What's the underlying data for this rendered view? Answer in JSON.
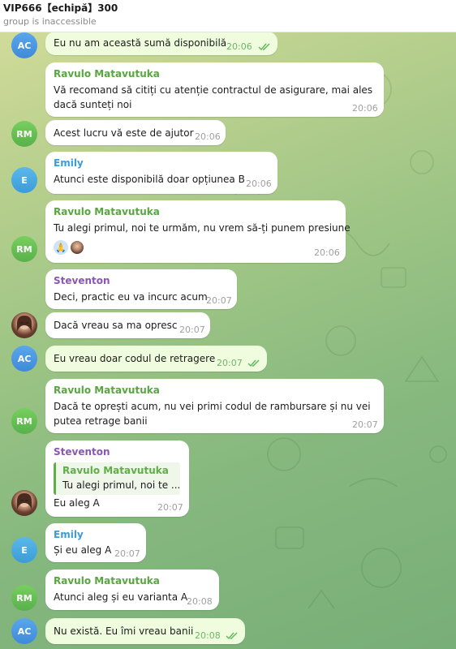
{
  "header": {
    "title": "VIP666【echipă】300",
    "subtitle": "group is inaccessible"
  },
  "messages": [
    {
      "avatar": "AC",
      "text": "Eu nu am această sumă disponibilă",
      "time": "20:06"
    },
    {
      "sender": "Ravulo Matavutuka",
      "lines": [
        "Vă recomand să citiți cu atenție contractul de asigurare, mai ales",
        "dacă sunteți noi"
      ],
      "time": "20:06"
    },
    {
      "avatar": "RM",
      "text": "Acest lucru vă este de ajutor",
      "time": "20:06"
    },
    {
      "avatar": "E",
      "sender": "Emily",
      "text": "Atunci este disponibilă doar opțiunea B",
      "time": "20:06"
    },
    {
      "avatar": "RM",
      "sender": "Ravulo Matavutuka",
      "text": "Tu alegi primul, noi te urmăm, nu vrem să-ți punem presiune",
      "time": "20:06",
      "reaction": "🙏"
    },
    {
      "sender": "Steventon",
      "text": "Deci, practic eu va incurc acum",
      "time": "20:07"
    },
    {
      "text": "Dacă vreau sa ma opresc",
      "time": "20:07"
    },
    {
      "avatar": "AC",
      "text": "Eu vreau doar codul de retragere",
      "time": "20:07"
    },
    {
      "avatar": "RM",
      "sender": "Ravulo Matavutuka",
      "lines": [
        "Dacă te oprești acum, nu vei primi codul de rambursare și nu vei",
        "putea retrage banii"
      ],
      "time": "20:07"
    },
    {
      "sender": "Steventon",
      "reply_name": "Ravulo Matavutuka",
      "reply_text": "Tu alegi primul, noi te ...",
      "text": "Eu aleg A",
      "time": "20:07"
    },
    {
      "avatar": "E",
      "sender": "Emily",
      "text": "Și eu aleg A",
      "time": "20:07"
    },
    {
      "avatar": "RM",
      "sender": "Ravulo Matavutuka",
      "text": "Atunci aleg și eu varianta A",
      "time": "20:08"
    },
    {
      "avatar": "AC",
      "text": "Nu există. Eu îmi vreau banii",
      "time": "20:08"
    }
  ],
  "colors": {
    "outgoing_bubble": "#effdde",
    "incoming_bubble": "#ffffff",
    "ravulo_name": "#58a640",
    "emily_name": "#3d9bd6",
    "steventon_name": "#8a56b3"
  }
}
